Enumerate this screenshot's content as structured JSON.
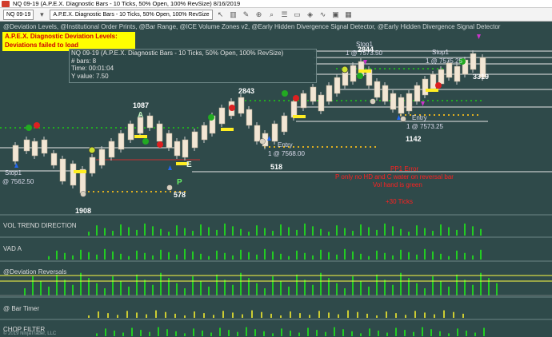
{
  "window": {
    "title": "NQ 09-19 (A.P.E.X. Diagnostic Bars - 10 Ticks, 50% Open, 100% RevSize)  8/16/2019"
  },
  "toolbar": {
    "instrument": "NQ 09-19",
    "bar_type": "A.P.E.X. Diagnostic Bars - 10 Ticks, 50% Open, 100% RevSize",
    "icons": [
      "pointer-icon",
      "bar-style-icon",
      "pencil-icon",
      "zoom-icon",
      "search-icon",
      "properties-icon",
      "window-icon",
      "strategy-icon",
      "indicator-icon",
      "lock-icon",
      "grid-icon"
    ]
  },
  "chart": {
    "indicators_header": "@Deviation Levels, @Institutional Order Prints, @Bar Range, @ICE Volume Zones v2, @Early Hidden Divergence Signal Detector, @Early Hidden Divergence Signal Detector",
    "alert_line1": "A.P.E.X. Diagnostic Deviation Levels:",
    "alert_line2": "Deviations failed to load",
    "info": {
      "line1": "NQ 09-19 (A.P.E.X. Diagnostic Bars - 10 Ticks, 50% Open, 100% RevSize)",
      "bars": "# bars:   8",
      "time": "Time:     00:01:04",
      "yvalue": "Y value:  7.50"
    },
    "price_labels": {
      "p1908": "1908",
      "p1087": "1087",
      "p2843": "2843",
      "p2844": "2844",
      "p3319": "3319",
      "p518": "518",
      "p578": "578",
      "p1142": "1142"
    },
    "order_labels": {
      "stop1_left": "Stop1",
      "stop1_left_price": "@ 7562.50",
      "stop1_top": "Stop1",
      "stop1_top_price": "1 @ 7573.50",
      "stop1_right": "Stop1",
      "stop1_right_price": "1 @ 7575.25",
      "entry_mid": "Entry",
      "entry_mid_price": "1 @ 7568.00",
      "entry_right": "Entry",
      "entry_right_price": "1 @ 7573.25"
    },
    "markers": {
      "p": "P",
      "e": "E",
      "a": "A"
    },
    "annotation": {
      "line1": "PP1 Error",
      "line2": "P only no HD and C water on reversal bar",
      "line3": "Vol hand is green",
      "line4": "+30 Ticks"
    },
    "panels": {
      "vol_trend": "VOL TREND DIRECTION",
      "vad": "VAD A",
      "dev_rev": "@Deviation Reversals",
      "bar_timer": "@ Bar Timer",
      "chop": "CHOP FILTER"
    },
    "copyright": "© 2019 NinjaTrader, LLC"
  },
  "colors": {
    "background": "#2f4a4a",
    "bull_candle": "#f5ead9",
    "bear_candle": "#f5ead9",
    "alert_bg": "#ffff00",
    "alert_text": "#d00000",
    "annotation_text": "#ff2020",
    "green_dots": "#22aa22",
    "yellow_dots": "#e0b020",
    "volume_green": "#22cc22"
  }
}
